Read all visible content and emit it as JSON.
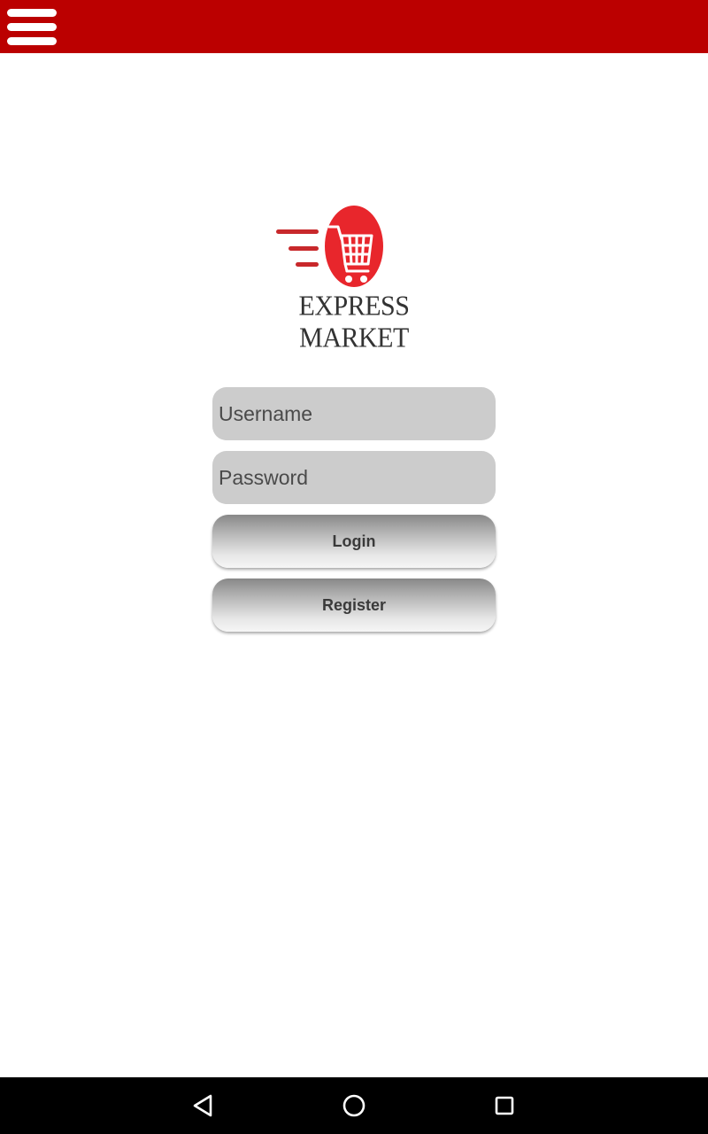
{
  "app": {
    "brand_name": "EXPRESS MARKET",
    "colors": {
      "appbar": "#bb0000",
      "logo_red": "#e8262c",
      "field_bg": "#cccccc",
      "navbar": "#000000"
    }
  },
  "appbar": {
    "menu_icon": "hamburger-menu-icon"
  },
  "logo": {
    "icon": "shopping-cart-icon",
    "text": "EXPRESS MARKET"
  },
  "form": {
    "username_placeholder": "Username",
    "username_value": "",
    "password_placeholder": "Password",
    "password_value": "",
    "login_label": "Login",
    "register_label": "Register"
  },
  "navbar": {
    "icons": [
      "back-icon",
      "home-icon",
      "recents-icon"
    ]
  }
}
